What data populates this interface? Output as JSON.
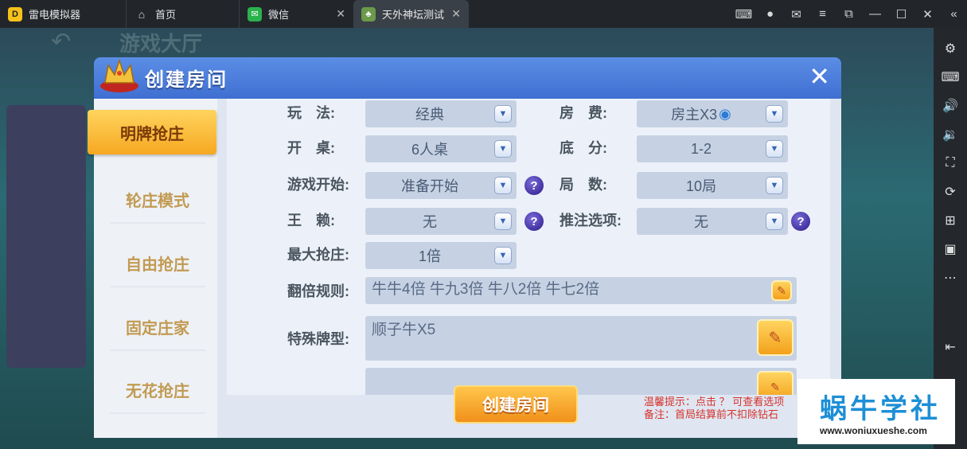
{
  "titlebar": {
    "app_name": "雷电模拟器",
    "tabs": [
      {
        "label": "首页"
      },
      {
        "label": "微信"
      },
      {
        "label": "天外神坛测试"
      }
    ]
  },
  "game": {
    "back_text": "↶",
    "hall_title": "游戏大厅"
  },
  "dialog": {
    "title": "创建房间",
    "modes": [
      "明牌抢庄",
      "轮庄模式",
      "自由抢庄",
      "固定庄家",
      "无花抢庄"
    ],
    "selected_mode": "明牌抢庄",
    "fields": {
      "play": {
        "label": "玩　法:",
        "value": "经典"
      },
      "fee": {
        "label": "房　费:",
        "value": "房主X3"
      },
      "table": {
        "label": "开　桌:",
        "value": "6人桌"
      },
      "base": {
        "label": "底　分:",
        "value": "1-2"
      },
      "start": {
        "label": "游戏开始:",
        "value": "准备开始"
      },
      "rounds": {
        "label": "局　数:",
        "value": "10局"
      },
      "wild": {
        "label": "王　赖:",
        "value": "无"
      },
      "bet_option": {
        "label": "推注选项:",
        "value": "无"
      },
      "max_banker": {
        "label": "最大抢庄:",
        "value": "1倍"
      },
      "double_rule": {
        "label": "翻倍规则:",
        "value": "牛牛4倍 牛九3倍 牛八2倍 牛七2倍"
      },
      "special": {
        "label": "特殊牌型:",
        "value": "顺子牛X5"
      }
    },
    "help_label": "?",
    "create_button": "创建房间",
    "tip1": "温馨提示：点击 ？ 可查看选项",
    "tip2": "备注：首局结算前不扣除钻石"
  },
  "watermark": {
    "brand": "蜗牛学社",
    "url": "www.woniuxueshe.com"
  }
}
